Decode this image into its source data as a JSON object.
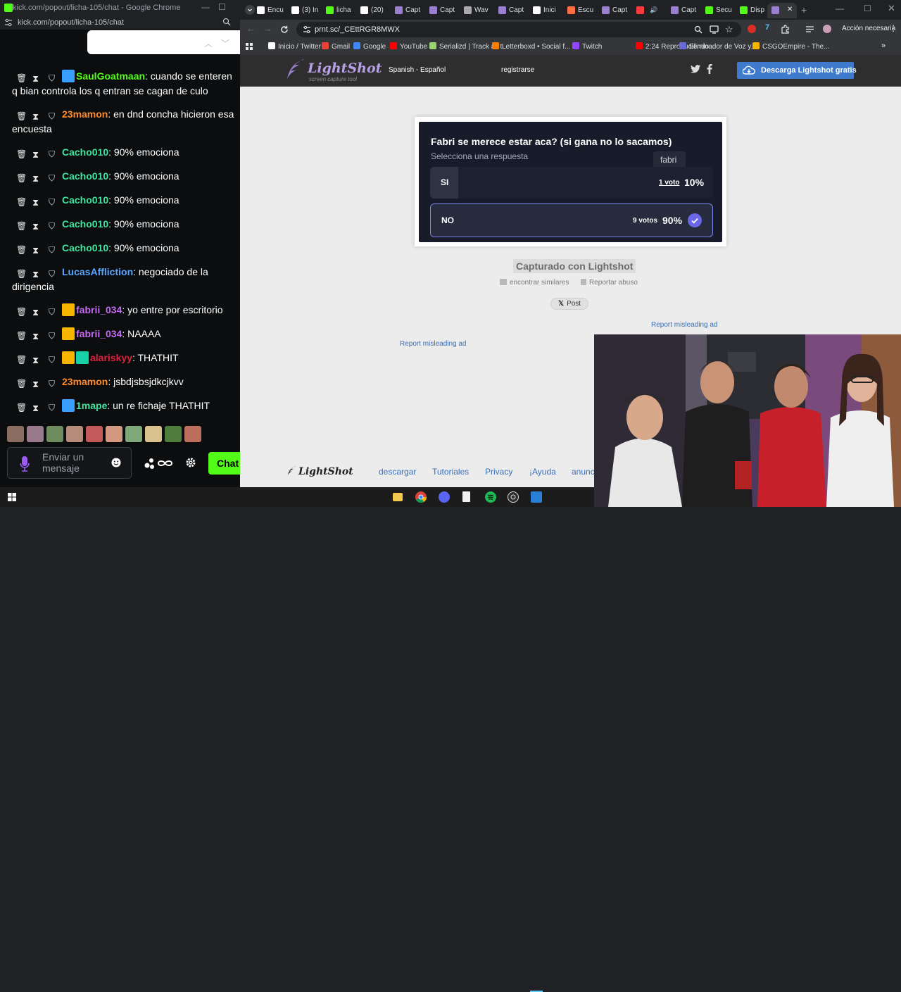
{
  "left_window": {
    "title": "kick.com/popout/licha-105/chat - Google Chrome",
    "url": "kick.com/popout/licha-105/chat",
    "messages": [
      {
        "user": "SaulGoatmaan",
        "user_color": "#53fc18",
        "badges": [
          "blue"
        ],
        "text": ": cuando se enteren q bian controla los q entran se cagan de culo"
      },
      {
        "user": "23mamon",
        "user_color": "#ff8c2a",
        "badges": [],
        "text": ": en dnd concha hicieron esa encuesta"
      },
      {
        "user": "Cacho010",
        "user_color": "#3ee6a0",
        "badges": [],
        "text": ": 90% emociona"
      },
      {
        "user": "Cacho010",
        "user_color": "#3ee6a0",
        "badges": [],
        "text": ": 90% emociona"
      },
      {
        "user": "Cacho010",
        "user_color": "#3ee6a0",
        "badges": [],
        "text": ": 90% emociona"
      },
      {
        "user": "Cacho010",
        "user_color": "#3ee6a0",
        "badges": [],
        "text": ": 90% emociona"
      },
      {
        "user": "Cacho010",
        "user_color": "#3ee6a0",
        "badges": [],
        "text": ": 90% emociona"
      },
      {
        "user": "LucasAffliction",
        "user_color": "#58a6ff",
        "badges": [],
        "text": ": negociado de la dirigencia"
      },
      {
        "user": "fabrii_034",
        "user_color": "#c26cf0",
        "badges": [
          "crown"
        ],
        "text": ": yo entre por escritorio"
      },
      {
        "user": "fabrii_034",
        "user_color": "#c26cf0",
        "badges": [
          "crown"
        ],
        "text": ": NAAAA"
      },
      {
        "user": "alariskyy",
        "user_color": "#e0213b",
        "badges": [
          "crown",
          "green"
        ],
        "text": ": THATHIT"
      },
      {
        "user": "23mamon",
        "user_color": "#ff8c2a",
        "badges": [],
        "text": ": jsbdjsbsjdkcjkvv"
      },
      {
        "user": "1mape",
        "user_color": "#3ee6a0",
        "badges": [
          "blue"
        ],
        "text": ": un re fichaje THATHIT"
      }
    ],
    "chat_input": {
      "placeholder": "Enviar un mensaje"
    },
    "chat_button": "Chat"
  },
  "browser": {
    "tabs": [
      "Encu",
      "(3) In",
      "licha",
      "(20)",
      "Capt",
      "Capt",
      "Wav",
      "Capt",
      "Inici",
      "Escu",
      "Capt",
      "",
      "Capt",
      "Secu",
      "Disp",
      ""
    ],
    "url": "prnt.sc/_CEttRGR8MWX",
    "bookmarks": [
      "Inicio / Twitter",
      "Gmail",
      "Google",
      "YouTube",
      "Serializd | Track all t...",
      "Letterboxd • Social f...",
      "Twitch",
      "2:24 Reproduciendo...",
      "Eliminador de Voz y...",
      "CSGOEmpire - The..."
    ],
    "profile_label": "Acción necesaria"
  },
  "lightshot": {
    "logo": "LightShot",
    "logo_tagline": "screen capture tool",
    "language": "Spanish - Español",
    "register": "registrarse",
    "download_button": "Descarga Lightshot gratis",
    "captured_label": "Capturado con Lightshot",
    "find_similar": "encontrar similares",
    "report_abuse": "Reportar abuso",
    "post_button": "Post",
    "report_ad_1": "Report misleading ad",
    "report_ad_2": "Report misleading ad",
    "footer_logo": "LightShot",
    "footer_links": [
      "descargar",
      "Tutoriales",
      "Privacy",
      "¡Ayuda",
      "anunc"
    ]
  },
  "poll": {
    "question": "Fabri se merece estar aca? (si gana no lo sacamos)",
    "hint": "Selecciona una respuesta",
    "tooltip": "fabri",
    "options": [
      {
        "label": "SI",
        "votes": "1 voto",
        "percent": "10%",
        "fraction": 0.1,
        "selected": false
      },
      {
        "label": "NO",
        "votes": "9 votos",
        "percent": "90%",
        "fraction": 0.9,
        "selected": true
      }
    ]
  },
  "colors": {
    "kick_green": "#53fc18",
    "lightshot_blue": "#3f7acd",
    "poll_accent": "#6a67e8"
  }
}
